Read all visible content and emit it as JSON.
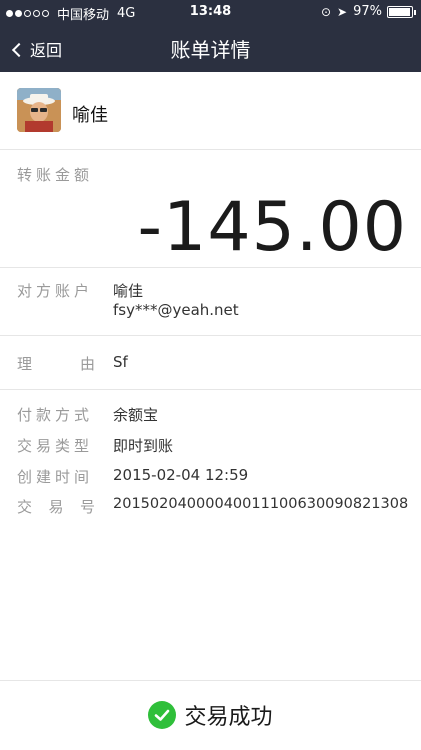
{
  "status_bar": {
    "carrier": "中国移动",
    "network": "4G",
    "time": "13:48",
    "battery": "97%"
  },
  "nav": {
    "back_label": "返回",
    "title": "账单详情"
  },
  "payee": {
    "name": "喻佳"
  },
  "amount": {
    "label": "转账金额",
    "value": "-145.00"
  },
  "counterparty": {
    "label": "对方账户",
    "name": "喻佳",
    "account": "fsy***@yeah.net"
  },
  "reason": {
    "label_a": "理",
    "label_b": "由",
    "value": "Sf"
  },
  "details": {
    "payment_method_label": "付款方式",
    "payment_method": "余额宝",
    "trade_type_label": "交易类型",
    "trade_type": "即时到账",
    "created_label": "创建时间",
    "created": "2015-02-04 12:59",
    "trade_no_label_a": "交",
    "trade_no_label_b": "易",
    "trade_no_label_c": "号",
    "trade_no": "20150204000040011100630090821308"
  },
  "footer": {
    "status": "交易成功"
  },
  "colors": {
    "header_bg": "#2b3040",
    "success_green": "#2fbf3a"
  }
}
